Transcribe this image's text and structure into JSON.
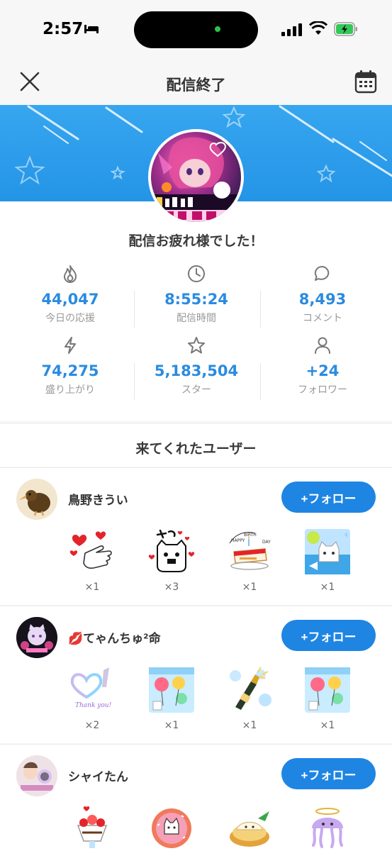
{
  "status": {
    "time": "2:57"
  },
  "nav": {
    "title": "配信終了"
  },
  "summary": {
    "message": "配信お疲れ様でした！",
    "stats": [
      {
        "icon": "flame-icon",
        "value": "44,047",
        "label": "今日の応援"
      },
      {
        "icon": "clock-icon",
        "value": "8:55:24",
        "label": "配信時間"
      },
      {
        "icon": "comment-icon",
        "value": "8,493",
        "label": "コメント"
      },
      {
        "icon": "lightning-icon",
        "value": "74,275",
        "label": "盛り上がり"
      },
      {
        "icon": "star-icon",
        "value": "5,183,504",
        "label": "スター"
      },
      {
        "icon": "person-icon",
        "value": "+24",
        "label": "フォロワー"
      }
    ]
  },
  "visitors": {
    "title": "来てくれたユーザー",
    "follow_label": "+フォロー",
    "users": [
      {
        "name": "鳥野きうい",
        "gifts": [
          {
            "icon": "heart-hand-sticker",
            "count": "×1"
          },
          {
            "icon": "cat-sugoi-sticker",
            "count": "×3"
          },
          {
            "icon": "birthday-cake-sticker",
            "count": "×1"
          },
          {
            "icon": "cat-fish-sticker",
            "count": "×1"
          }
        ]
      },
      {
        "name": "💋てゃんちゅ²命",
        "gifts": [
          {
            "icon": "heart-thankyou-sticker",
            "count": "×2"
          },
          {
            "icon": "balloon-sticker",
            "count": "×1"
          },
          {
            "icon": "champagne-sticker",
            "count": "×1"
          },
          {
            "icon": "balloon-sticker",
            "count": "×1"
          }
        ]
      },
      {
        "name": "シャイたん",
        "gifts": [
          {
            "icon": "parfait-sticker",
            "count": ""
          },
          {
            "icon": "donut-cat-sticker",
            "count": ""
          },
          {
            "icon": "dumpling-sticker",
            "count": ""
          },
          {
            "icon": "jellyfish-sticker",
            "count": ""
          }
        ]
      }
    ]
  }
}
